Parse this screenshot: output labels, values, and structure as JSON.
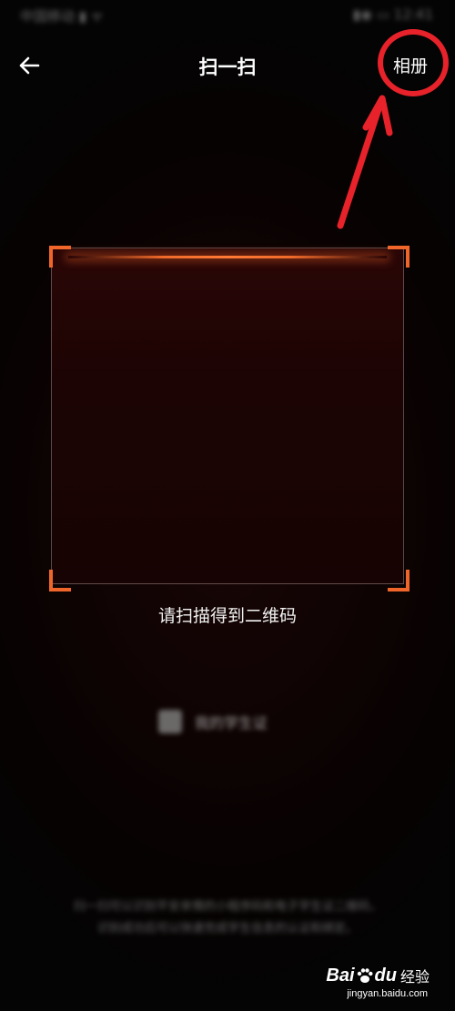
{
  "status_bar": {
    "left_text": "中国移动 ▮ ᯤ",
    "right_text": "▮◉ ▭ 12:41"
  },
  "nav": {
    "back_icon": "arrow-left-icon",
    "title": "扫一扫",
    "album_label": "相册"
  },
  "scanner": {
    "hint": "请扫描得到二维码",
    "accent_color": "#f0662a"
  },
  "my_code": {
    "icon": "qr-code-icon",
    "label": "我的学生证"
  },
  "footer_note": [
    "扫一扫可以识别平安亲情的小程序码和电子学生证二维码，",
    "识别成功后可以快速完成学生信息的认证和绑定。"
  ],
  "annotation": {
    "color": "#e8222a"
  },
  "watermark": {
    "brand_bai": "Bai",
    "brand_du": "du",
    "suffix": "经验",
    "url": "jingyan.baidu.com"
  }
}
